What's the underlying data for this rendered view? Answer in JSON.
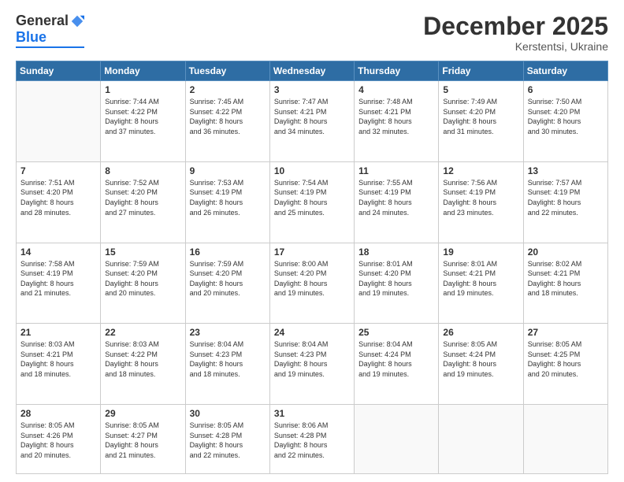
{
  "logo": {
    "general": "General",
    "blue": "Blue"
  },
  "header": {
    "month": "December 2025",
    "location": "Kerstentsi, Ukraine"
  },
  "weekdays": [
    "Sunday",
    "Monday",
    "Tuesday",
    "Wednesday",
    "Thursday",
    "Friday",
    "Saturday"
  ],
  "weeks": [
    [
      {
        "day": "",
        "info": ""
      },
      {
        "day": "1",
        "info": "Sunrise: 7:44 AM\nSunset: 4:22 PM\nDaylight: 8 hours\nand 37 minutes."
      },
      {
        "day": "2",
        "info": "Sunrise: 7:45 AM\nSunset: 4:22 PM\nDaylight: 8 hours\nand 36 minutes."
      },
      {
        "day": "3",
        "info": "Sunrise: 7:47 AM\nSunset: 4:21 PM\nDaylight: 8 hours\nand 34 minutes."
      },
      {
        "day": "4",
        "info": "Sunrise: 7:48 AM\nSunset: 4:21 PM\nDaylight: 8 hours\nand 32 minutes."
      },
      {
        "day": "5",
        "info": "Sunrise: 7:49 AM\nSunset: 4:20 PM\nDaylight: 8 hours\nand 31 minutes."
      },
      {
        "day": "6",
        "info": "Sunrise: 7:50 AM\nSunset: 4:20 PM\nDaylight: 8 hours\nand 30 minutes."
      }
    ],
    [
      {
        "day": "7",
        "info": "Sunrise: 7:51 AM\nSunset: 4:20 PM\nDaylight: 8 hours\nand 28 minutes."
      },
      {
        "day": "8",
        "info": "Sunrise: 7:52 AM\nSunset: 4:20 PM\nDaylight: 8 hours\nand 27 minutes."
      },
      {
        "day": "9",
        "info": "Sunrise: 7:53 AM\nSunset: 4:19 PM\nDaylight: 8 hours\nand 26 minutes."
      },
      {
        "day": "10",
        "info": "Sunrise: 7:54 AM\nSunset: 4:19 PM\nDaylight: 8 hours\nand 25 minutes."
      },
      {
        "day": "11",
        "info": "Sunrise: 7:55 AM\nSunset: 4:19 PM\nDaylight: 8 hours\nand 24 minutes."
      },
      {
        "day": "12",
        "info": "Sunrise: 7:56 AM\nSunset: 4:19 PM\nDaylight: 8 hours\nand 23 minutes."
      },
      {
        "day": "13",
        "info": "Sunrise: 7:57 AM\nSunset: 4:19 PM\nDaylight: 8 hours\nand 22 minutes."
      }
    ],
    [
      {
        "day": "14",
        "info": "Sunrise: 7:58 AM\nSunset: 4:19 PM\nDaylight: 8 hours\nand 21 minutes."
      },
      {
        "day": "15",
        "info": "Sunrise: 7:59 AM\nSunset: 4:20 PM\nDaylight: 8 hours\nand 20 minutes."
      },
      {
        "day": "16",
        "info": "Sunrise: 7:59 AM\nSunset: 4:20 PM\nDaylight: 8 hours\nand 20 minutes."
      },
      {
        "day": "17",
        "info": "Sunrise: 8:00 AM\nSunset: 4:20 PM\nDaylight: 8 hours\nand 19 minutes."
      },
      {
        "day": "18",
        "info": "Sunrise: 8:01 AM\nSunset: 4:20 PM\nDaylight: 8 hours\nand 19 minutes."
      },
      {
        "day": "19",
        "info": "Sunrise: 8:01 AM\nSunset: 4:21 PM\nDaylight: 8 hours\nand 19 minutes."
      },
      {
        "day": "20",
        "info": "Sunrise: 8:02 AM\nSunset: 4:21 PM\nDaylight: 8 hours\nand 18 minutes."
      }
    ],
    [
      {
        "day": "21",
        "info": "Sunrise: 8:03 AM\nSunset: 4:21 PM\nDaylight: 8 hours\nand 18 minutes."
      },
      {
        "day": "22",
        "info": "Sunrise: 8:03 AM\nSunset: 4:22 PM\nDaylight: 8 hours\nand 18 minutes."
      },
      {
        "day": "23",
        "info": "Sunrise: 8:04 AM\nSunset: 4:23 PM\nDaylight: 8 hours\nand 18 minutes."
      },
      {
        "day": "24",
        "info": "Sunrise: 8:04 AM\nSunset: 4:23 PM\nDaylight: 8 hours\nand 19 minutes."
      },
      {
        "day": "25",
        "info": "Sunrise: 8:04 AM\nSunset: 4:24 PM\nDaylight: 8 hours\nand 19 minutes."
      },
      {
        "day": "26",
        "info": "Sunrise: 8:05 AM\nSunset: 4:24 PM\nDaylight: 8 hours\nand 19 minutes."
      },
      {
        "day": "27",
        "info": "Sunrise: 8:05 AM\nSunset: 4:25 PM\nDaylight: 8 hours\nand 20 minutes."
      }
    ],
    [
      {
        "day": "28",
        "info": "Sunrise: 8:05 AM\nSunset: 4:26 PM\nDaylight: 8 hours\nand 20 minutes."
      },
      {
        "day": "29",
        "info": "Sunrise: 8:05 AM\nSunset: 4:27 PM\nDaylight: 8 hours\nand 21 minutes."
      },
      {
        "day": "30",
        "info": "Sunrise: 8:05 AM\nSunset: 4:28 PM\nDaylight: 8 hours\nand 22 minutes."
      },
      {
        "day": "31",
        "info": "Sunrise: 8:06 AM\nSunset: 4:28 PM\nDaylight: 8 hours\nand 22 minutes."
      },
      {
        "day": "",
        "info": ""
      },
      {
        "day": "",
        "info": ""
      },
      {
        "day": "",
        "info": ""
      }
    ]
  ]
}
